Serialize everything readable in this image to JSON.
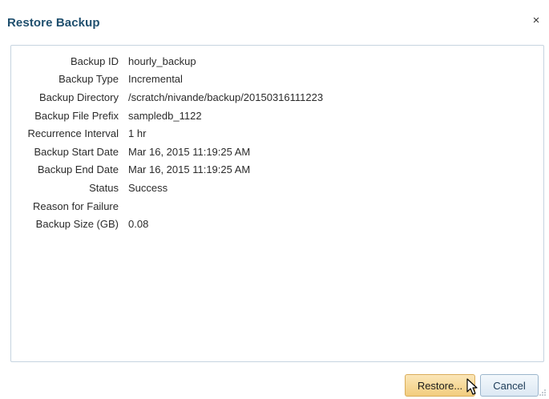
{
  "dialog": {
    "title": "Restore Backup",
    "close_label": "×"
  },
  "properties": [
    {
      "label": "Backup ID",
      "value": "hourly_backup"
    },
    {
      "label": "Backup Type",
      "value": "Incremental"
    },
    {
      "label": "Backup Directory",
      "value": "/scratch/nivande/backup/20150316111223"
    },
    {
      "label": "Backup File Prefix",
      "value": "sampledb_1122"
    },
    {
      "label": "Recurrence Interval",
      "value": "1 hr"
    },
    {
      "label": "Backup Start Date",
      "value": "Mar 16, 2015 11:19:25 AM"
    },
    {
      "label": "Backup End Date",
      "value": "Mar 16, 2015 11:19:25 AM"
    },
    {
      "label": "Status",
      "value": "Success"
    },
    {
      "label": "Reason for Failure",
      "value": ""
    },
    {
      "label": "Backup Size (GB)",
      "value": "0.08"
    }
  ],
  "footer": {
    "restore_label": "Restore...",
    "cancel_label": "Cancel"
  },
  "colors": {
    "title": "#1f4f6e",
    "restore_button": "#f2cd7e",
    "cancel_button": "#dce8f3",
    "panel_border": "#c6d4e0"
  },
  "icons": {
    "close": "close-icon",
    "cursor": "mouse-pointer-icon",
    "resize": "resize-grip-icon"
  }
}
